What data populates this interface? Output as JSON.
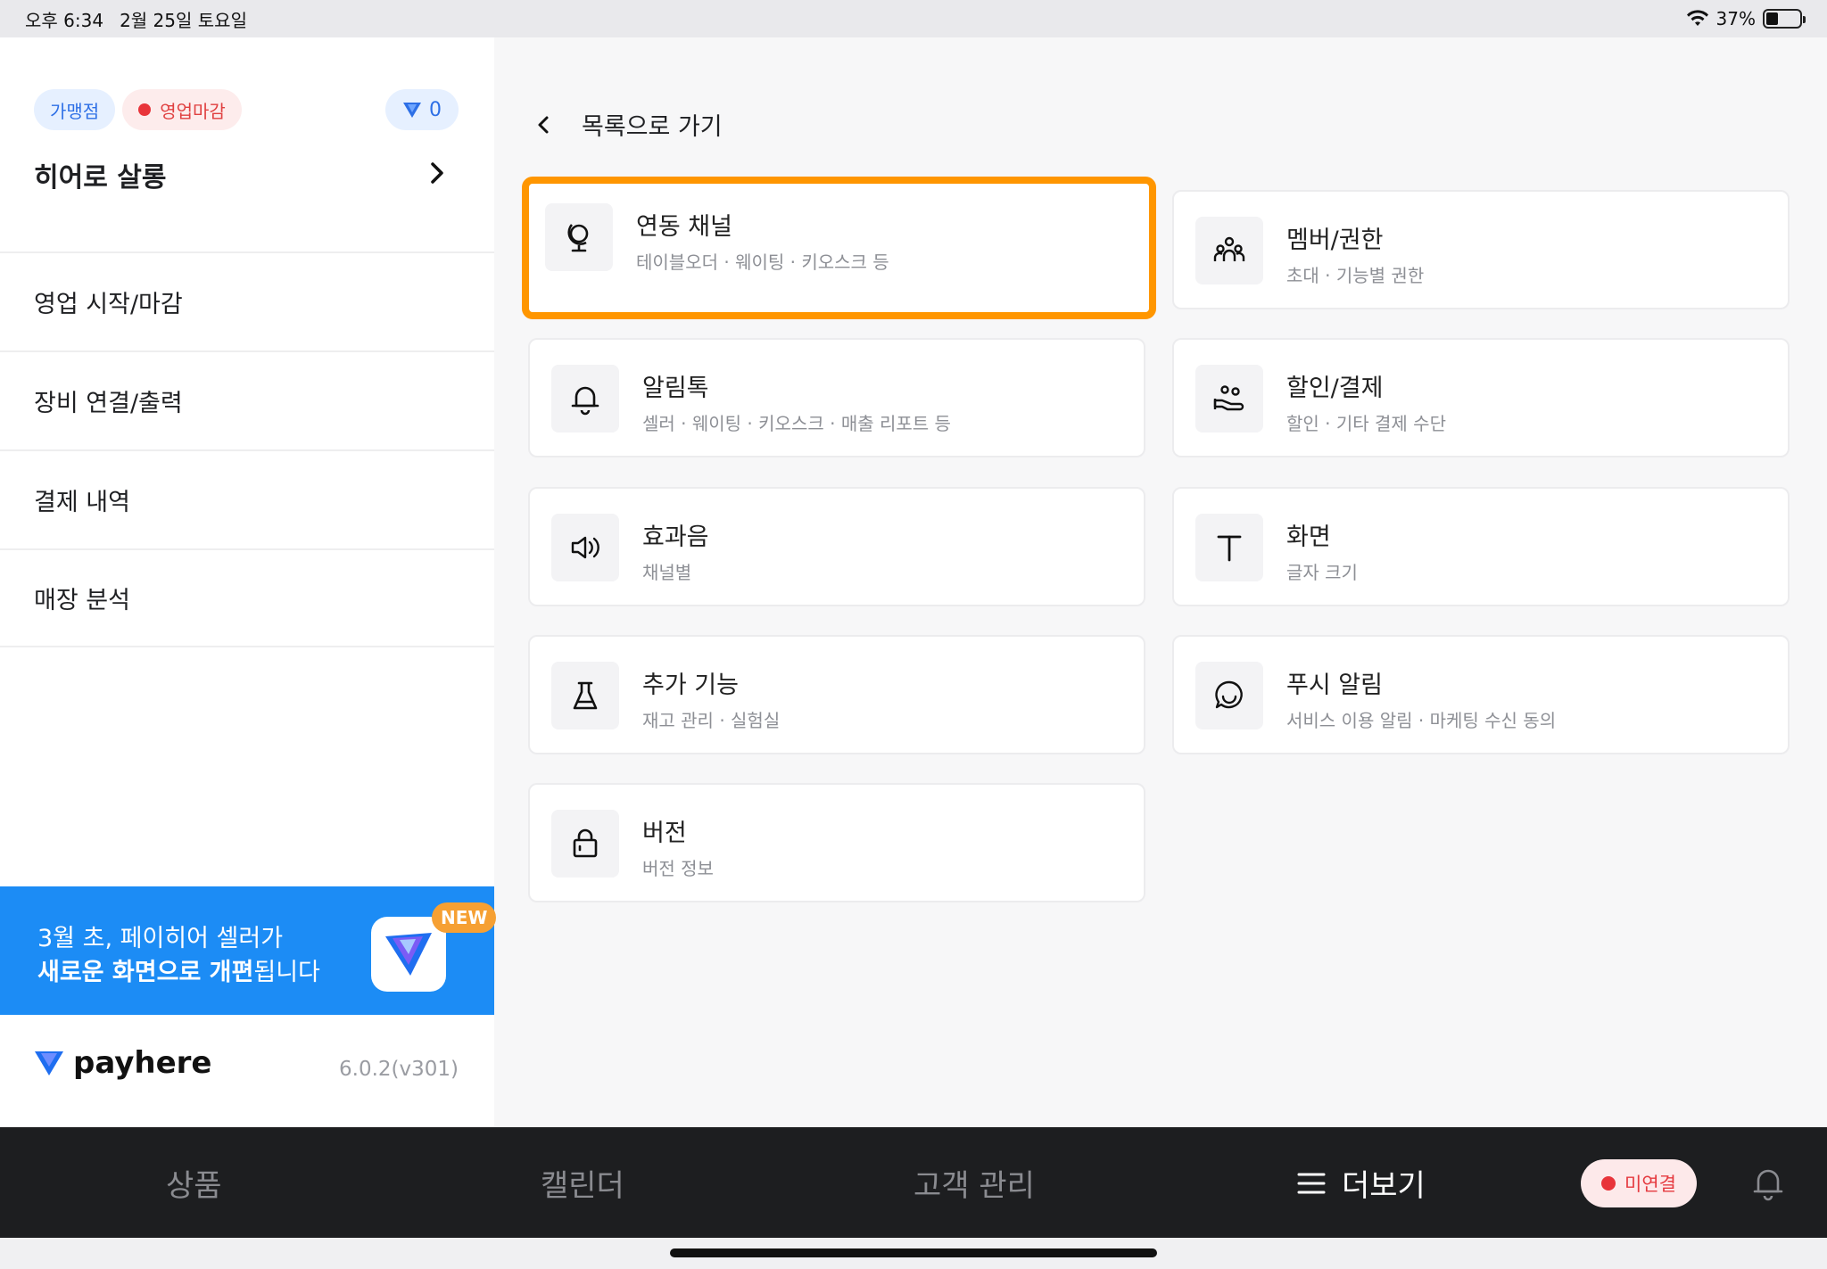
{
  "status_bar": {
    "time": "오후 6:34",
    "date": "2월 25일 토요일",
    "battery": "37%",
    "battery_level": 0.37
  },
  "sidebar": {
    "chip_store_type": "가맹점",
    "chip_status": "영업마감",
    "points": "0",
    "store_name": "히어로 살롱",
    "menu": [
      {
        "label": "영업 시작/마감"
      },
      {
        "label": "장비 연결/출력"
      },
      {
        "label": "결제 내역"
      },
      {
        "label": "매장 분석"
      }
    ],
    "banner": {
      "line1": "3월 초, 페이히어 셀러가",
      "line2_bold1": "새로운 화면으로 개편",
      "line2_rest": "됩니다",
      "badge": "NEW"
    },
    "brand": "payhere",
    "version": "6.0.2(v301)"
  },
  "main": {
    "back_label": "목록으로 가기",
    "cards": [
      {
        "title": "연동 채널",
        "sub": "테이블오더 · 웨이팅 · 키오스크 등",
        "icon": "globe-icon",
        "selected": true
      },
      {
        "title": "멤버/권한",
        "sub": "초대 · 기능별 권한",
        "icon": "members-icon"
      },
      {
        "title": "알림톡",
        "sub": "셀러 · 웨이팅 · 키오스크 · 매출 리포트 등",
        "icon": "bell-icon"
      },
      {
        "title": "할인/결제",
        "sub": "할인 · 기타 결제 수단",
        "icon": "payment-hand-icon"
      },
      {
        "title": "효과음",
        "sub": "채널별",
        "icon": "speaker-icon"
      },
      {
        "title": "화면",
        "sub": "글자 크기",
        "icon": "text-size-icon"
      },
      {
        "title": "추가 기능",
        "sub": "재고 관리 · 실험실",
        "icon": "flask-icon"
      },
      {
        "title": "푸시 알림",
        "sub": "서비스 이용 알림 · 마케팅 수신 동의",
        "icon": "chat-smile-icon"
      },
      {
        "title": "버전",
        "sub": "버전 정보",
        "icon": "lock-icon"
      }
    ]
  },
  "tabbar": {
    "tabs": [
      {
        "label": "상품"
      },
      {
        "label": "캘린더"
      },
      {
        "label": "고객 관리"
      },
      {
        "label": "더보기",
        "active": true
      }
    ],
    "connection": "미연결"
  },
  "colors": {
    "accent_blue": "#1c8cf5",
    "highlight_orange": "#ff9600",
    "alert_red": "#e8343a"
  }
}
